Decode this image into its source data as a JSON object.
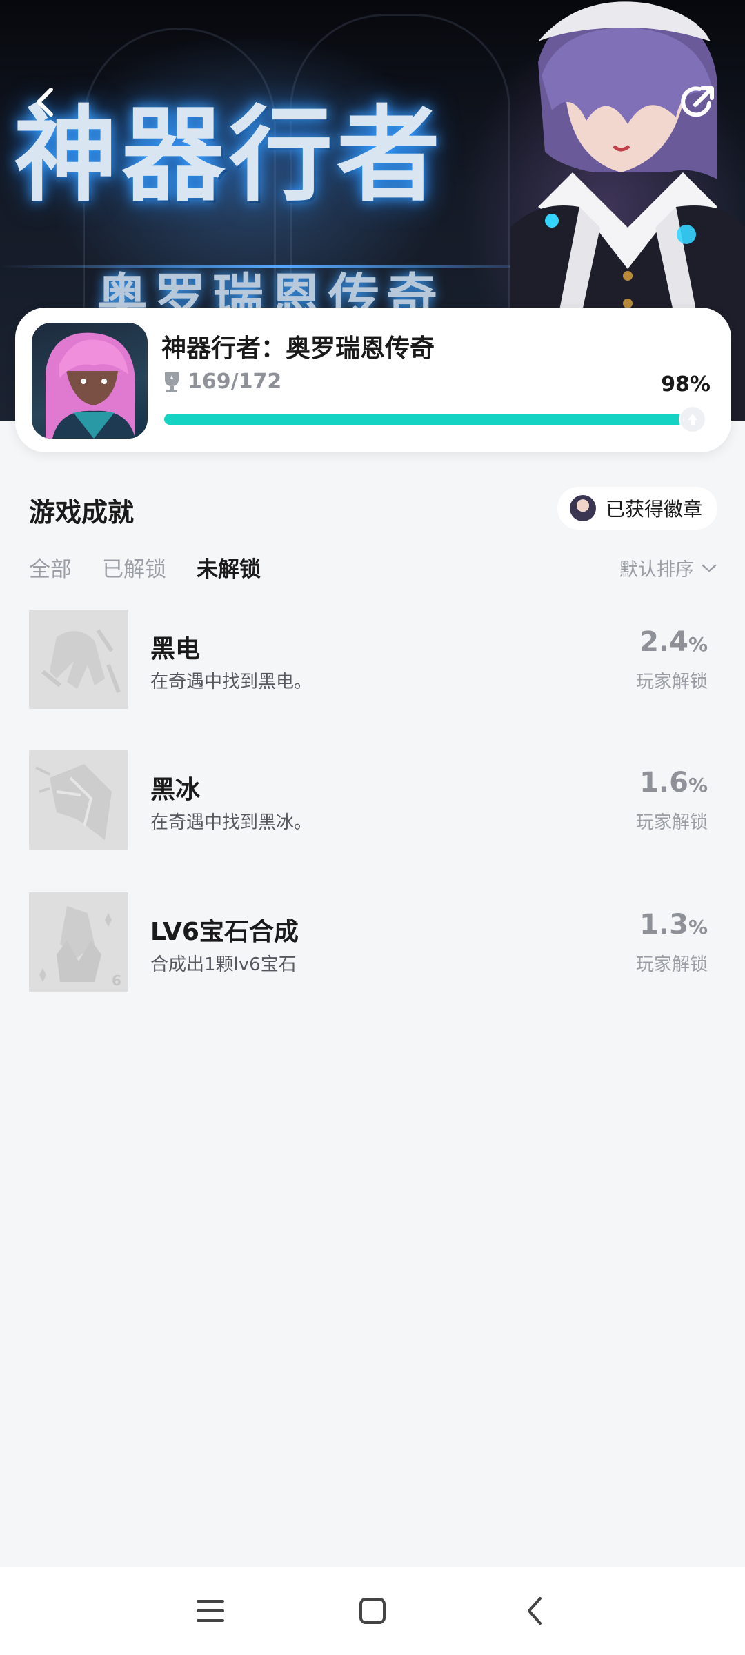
{
  "header": {
    "back_icon": "chevron-left-icon",
    "share_icon": "share-icon",
    "banner_title": "神器行者",
    "banner_subtitle": "奥罗瑞恩传奇"
  },
  "game": {
    "name": "神器行者：奥罗瑞恩传奇",
    "trophy_icon": "trophy-icon",
    "trophy_count": "169/172",
    "percent": "98%",
    "progress": 0.98
  },
  "section": {
    "title": "游戏成就",
    "badge_button_label": "已获得徽章"
  },
  "tabs": [
    {
      "label": "全部",
      "active": false
    },
    {
      "label": "已解锁",
      "active": false
    },
    {
      "label": "未解锁",
      "active": true
    }
  ],
  "sort": {
    "label": "默认排序",
    "icon": "chevron-down-icon"
  },
  "achievements": [
    {
      "title": "黑电",
      "description": "在奇遇中找到黑电。",
      "percent": "2.4",
      "percent_unit": "%",
      "unlock_label": "玩家解锁",
      "icon": "black-lightning-icon"
    },
    {
      "title": "黑冰",
      "description": "在奇遇中找到黑冰。",
      "percent": "1.6",
      "percent_unit": "%",
      "unlock_label": "玩家解锁",
      "icon": "black-ice-icon"
    },
    {
      "title": "LV6宝石合成",
      "description": "合成出1颗lv6宝石",
      "percent": "1.3",
      "percent_unit": "%",
      "unlock_label": "玩家解锁",
      "icon": "gem-lv6-icon"
    }
  ],
  "navbar": {
    "menu_icon": "menu-icon",
    "home_icon": "home-square-icon",
    "back_icon": "back-arrow-icon"
  },
  "colors": {
    "accent": "#15d3c3",
    "background": "#f5f6f8"
  }
}
